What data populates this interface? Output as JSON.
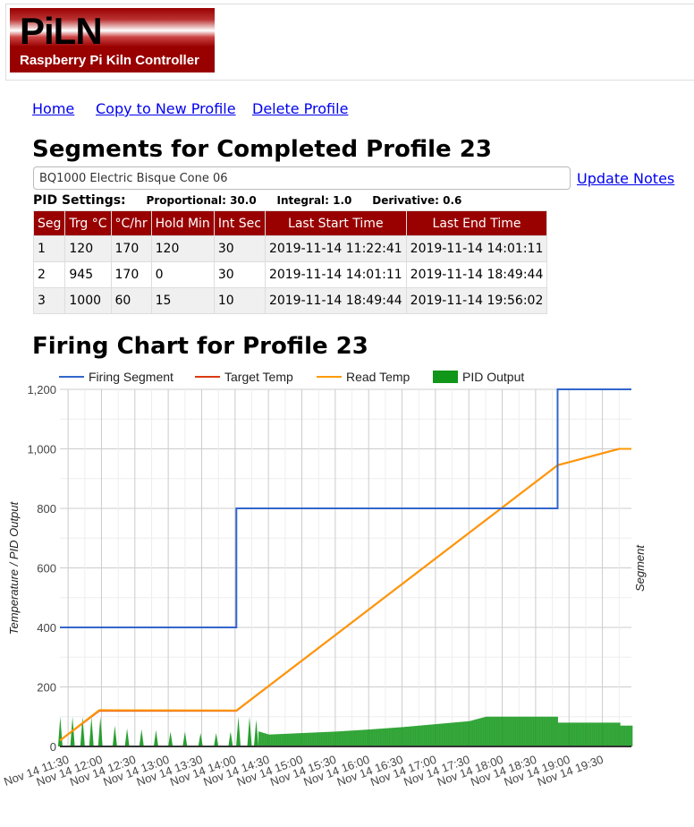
{
  "header": {
    "logo_text": "PiLN",
    "logo_subtitle": "Raspberry Pi Kiln Controller"
  },
  "nav": {
    "home": "Home",
    "copy": "Copy to New Profile",
    "delete": "Delete Profile"
  },
  "title": "Segments for Completed Profile 23",
  "notes": {
    "value": "BQ1000 Electric Bisque Cone 06",
    "update": "Update Notes"
  },
  "pid": {
    "label": "PID Settings:",
    "proportional": "Proportional: 30.0",
    "integral": "Integral: 1.0",
    "derivative": "Derivative: 0.6"
  },
  "table": {
    "headers": [
      "Seg",
      "Trg °C",
      "°C/hr",
      "Hold Min",
      "Int Sec",
      "Last Start Time",
      "Last End Time"
    ],
    "rows": [
      [
        "1",
        "120",
        "170",
        "120",
        "30",
        "2019-11-14 11:22:41",
        "2019-11-14 14:01:11"
      ],
      [
        "2",
        "945",
        "170",
        "0",
        "30",
        "2019-11-14 14:01:11",
        "2019-11-14 18:49:44"
      ],
      [
        "3",
        "1000",
        "60",
        "15",
        "10",
        "2019-11-14 18:49:44",
        "2019-11-14 19:56:02"
      ]
    ]
  },
  "chart_title": "Firing Chart for Profile 23",
  "chart_data": {
    "type": "line",
    "ylabel": "Temperature / PID Output",
    "y2label": "Segment",
    "ylim": [
      0,
      1200
    ],
    "yticks": [
      "0",
      "200",
      "400",
      "600",
      "800",
      "1,000",
      "1,200"
    ],
    "y2lim": [
      0,
      3
    ],
    "xlim": [
      "11:22:41",
      "19:56:02"
    ],
    "xticks": [
      "Nov 14 11:30",
      "Nov 14 12:00",
      "Nov 14 12:30",
      "Nov 14 13:00",
      "Nov 14 13:30",
      "Nov 14 14:00",
      "Nov 14 14:30",
      "Nov 14 15:00",
      "Nov 14 15:30",
      "Nov 14 16:00",
      "Nov 14 16:30",
      "Nov 14 17:00",
      "Nov 14 17:30",
      "Nov 14 18:00",
      "Nov 14 18:30",
      "Nov 14 19:00",
      "Nov 14 19:30"
    ],
    "grid": true,
    "legend_position": "top",
    "series": [
      {
        "name": "Firing Segment",
        "color": "#3366cc",
        "axis": "right",
        "step": true,
        "points": [
          [
            "11:22:41",
            1
          ],
          [
            "14:01:11",
            2
          ],
          [
            "18:49:44",
            3
          ],
          [
            "19:56:02",
            3
          ]
        ]
      },
      {
        "name": "Target Temp",
        "color": "#dc3912",
        "points": [
          [
            "11:22:41",
            20
          ],
          [
            "11:58",
            120
          ],
          [
            "14:01:11",
            120
          ],
          [
            "18:49:44",
            945
          ],
          [
            "19:45",
            1000
          ],
          [
            "19:56:02",
            1000
          ]
        ]
      },
      {
        "name": "Read Temp",
        "color": "#ff9900",
        "points": [
          [
            "11:22:41",
            20
          ],
          [
            "11:58",
            122
          ],
          [
            "14:01:11",
            121
          ],
          [
            "14:08",
            140
          ],
          [
            "18:49:44",
            945
          ],
          [
            "19:45",
            1000
          ],
          [
            "19:56:02",
            1000
          ]
        ]
      },
      {
        "name": "PID Output",
        "color": "#109618",
        "type": "bars",
        "spikes": [
          [
            "11:23",
            100
          ],
          [
            "11:34",
            100
          ],
          [
            "11:43",
            100
          ],
          [
            "11:51",
            100
          ],
          [
            "11:59",
            100
          ],
          [
            "12:12",
            70
          ],
          [
            "12:23",
            60
          ],
          [
            "12:36",
            58
          ],
          [
            "12:49",
            55
          ],
          [
            "13:02",
            50
          ],
          [
            "13:15",
            50
          ],
          [
            "13:29",
            45
          ],
          [
            "13:43",
            45
          ],
          [
            "13:56",
            50
          ],
          [
            "14:03",
            100
          ],
          [
            "14:13",
            100
          ],
          [
            "14:19",
            90
          ]
        ],
        "dense": [
          [
            "14:21",
            50
          ],
          [
            "14:30",
            40
          ],
          [
            "15:00",
            45
          ],
          [
            "15:30",
            50
          ],
          [
            "16:00",
            57
          ],
          [
            "16:30",
            65
          ],
          [
            "17:00",
            75
          ],
          [
            "17:30",
            85
          ],
          [
            "17:45",
            100
          ],
          [
            "18:49",
            100
          ],
          [
            "18:50",
            80
          ],
          [
            "19:45",
            80
          ],
          [
            "19:46",
            70
          ],
          [
            "19:56",
            70
          ]
        ]
      }
    ]
  }
}
